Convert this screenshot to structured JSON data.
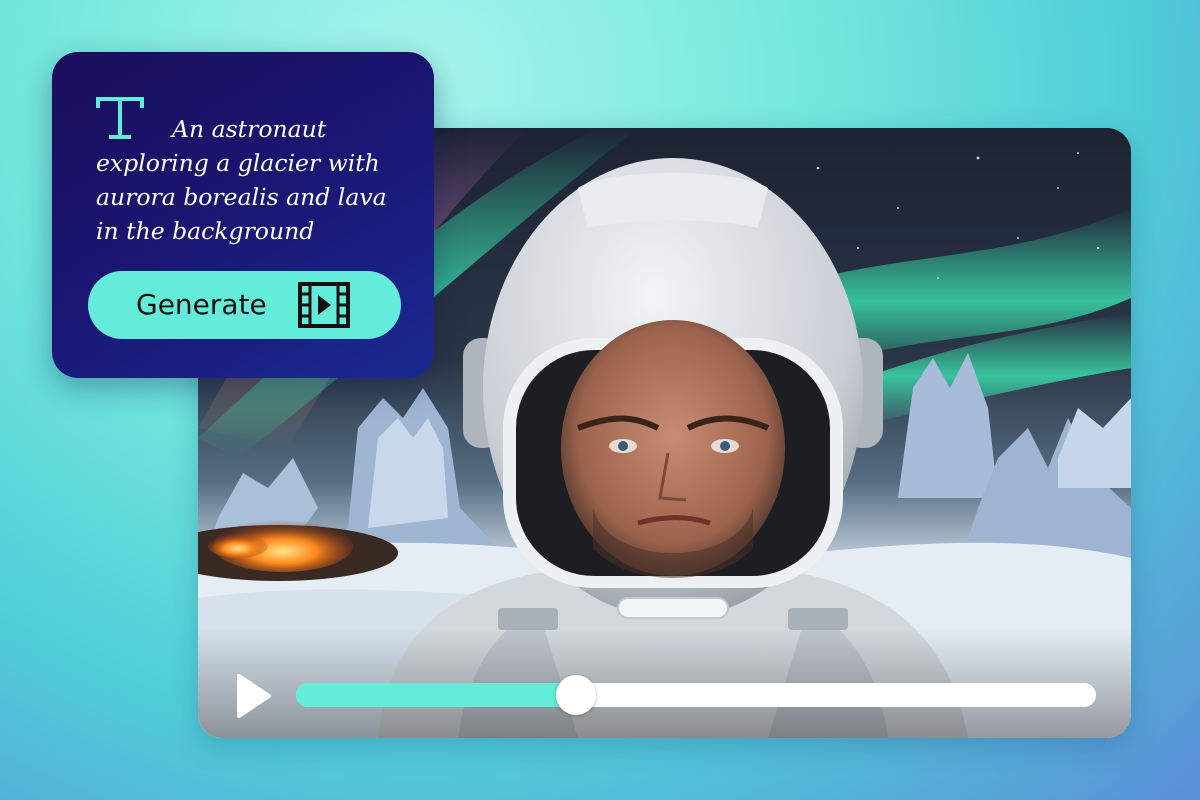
{
  "prompt_card": {
    "prompt_text": "An astronaut exploring a glacier with aurora borealis and lava in the background",
    "text_icon": "text-type-icon",
    "generate_label": "Generate",
    "generate_icon": "film-strip-play-icon",
    "accent_color": "#63ecd9"
  },
  "video_player": {
    "play_icon": "play-icon",
    "progress": 0.35
  },
  "colors": {
    "card_background": "#1a1570",
    "accent": "#63ecd9",
    "track": "#ffffff"
  }
}
